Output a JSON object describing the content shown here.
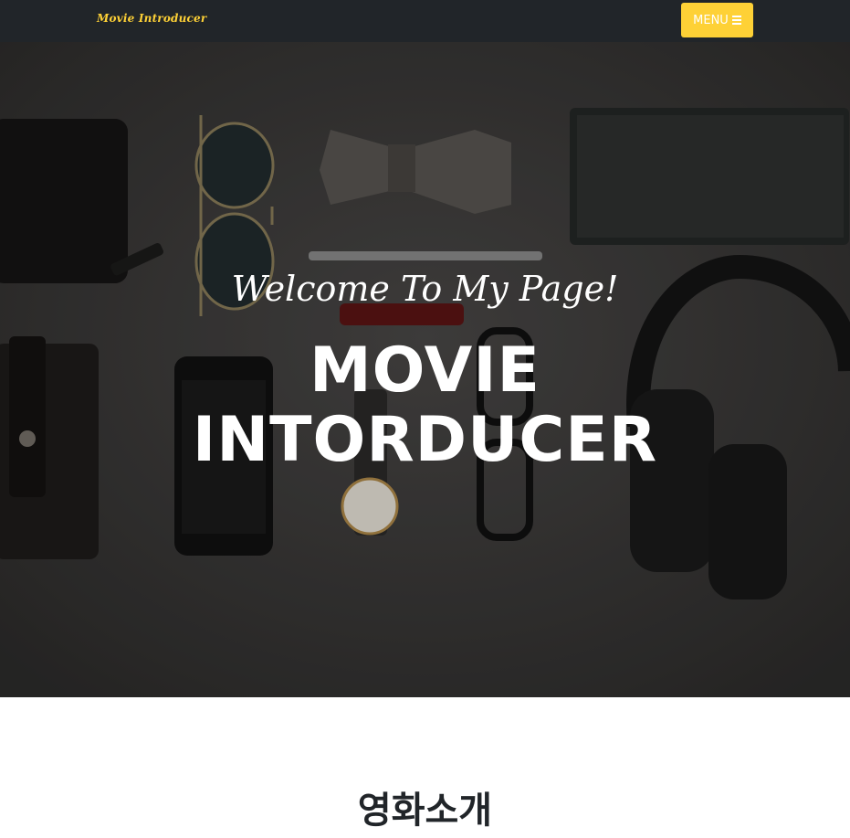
{
  "navbar": {
    "brand": "Movie Introducer",
    "menu_label": "MENU",
    "menu_icon": "bars-icon",
    "brand_color": "#fed136"
  },
  "hero": {
    "subheading": "Welcome To My Page!",
    "heading_line1": "MOVIE",
    "heading_line2": "INTORDUCER",
    "background": "flat-lay photo of wallet, sunglasses, bow tie, notebook, pen, phone, watch, glasses, headphones"
  },
  "section": {
    "heading": "영화소개"
  },
  "colors": {
    "navbar_bg": "#212529",
    "accent": "#fed136",
    "hero_overlay": "#3a3938"
  }
}
